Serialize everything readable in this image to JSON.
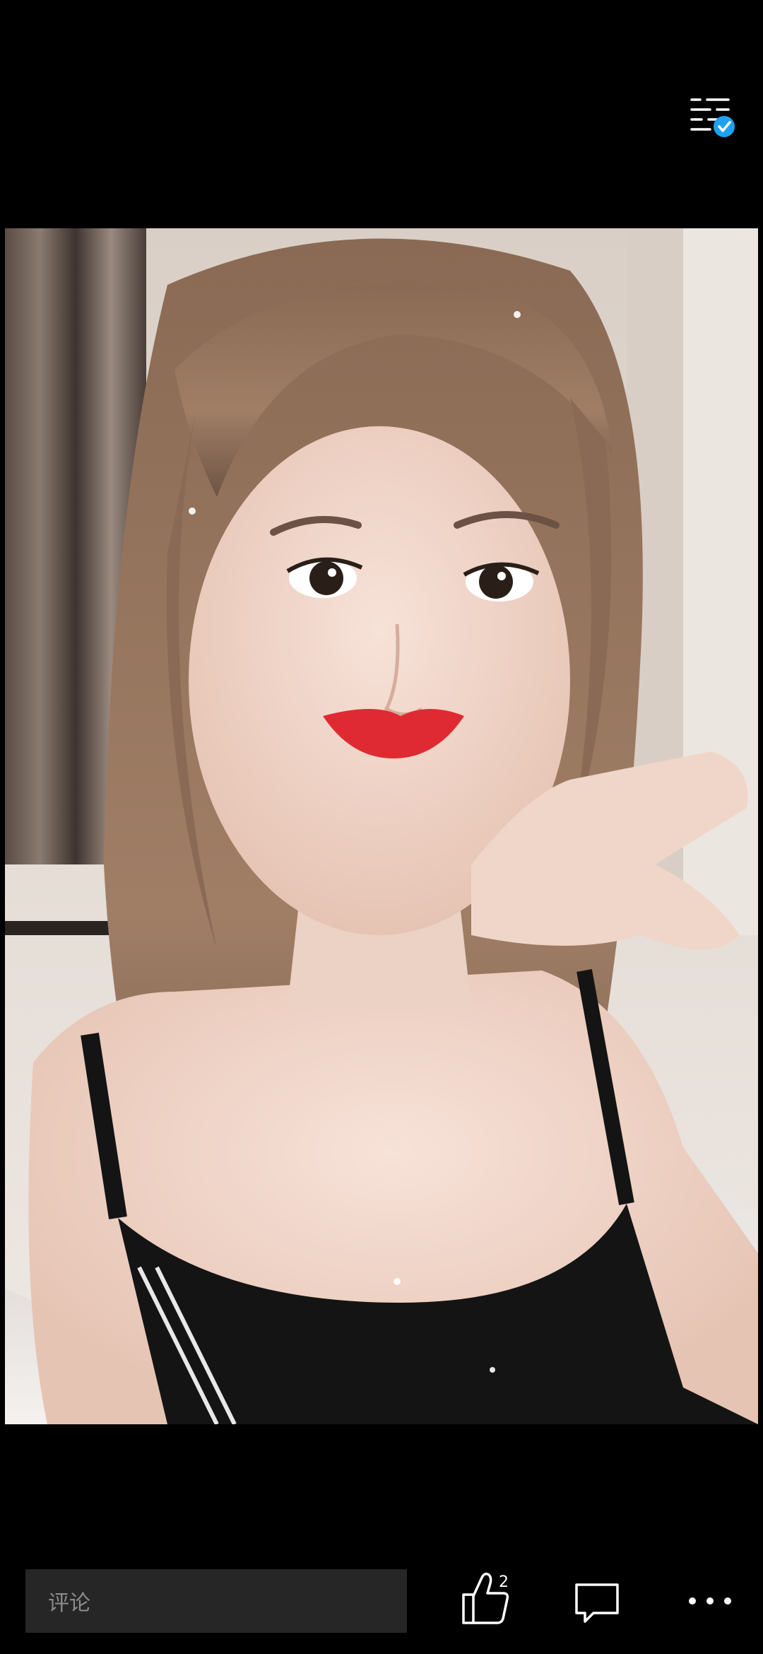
{
  "header": {
    "menu_icon": "list-settings-icon",
    "badge_icon": "verified-check-icon",
    "badge_color": "#1DA1F2"
  },
  "photo": {
    "subject": "selfie-photo"
  },
  "bottom_bar": {
    "comment_placeholder": "评论",
    "like_icon": "thumbs-up-icon",
    "like_count": "2",
    "comment_icon": "speech-bubble-icon",
    "more_icon": "more-dots-icon"
  },
  "colors": {
    "background": "#000000",
    "comment_box": "#262626",
    "placeholder_text": "#8c8c8c",
    "icon": "#ffffff"
  }
}
